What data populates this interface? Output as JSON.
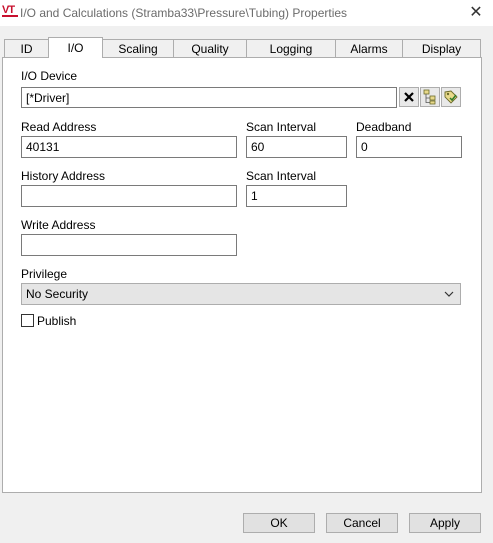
{
  "window": {
    "title": "I/O and Calculations (Stramba33\\Pressure\\Tubing) Properties",
    "icon": "vtscada-logo-icon",
    "logo_text": "VT"
  },
  "tabs": [
    {
      "label": "ID",
      "active": false
    },
    {
      "label": "I/O",
      "active": true
    },
    {
      "label": "Scaling",
      "active": false
    },
    {
      "label": "Quality",
      "active": false
    },
    {
      "label": "Logging",
      "active": false
    },
    {
      "label": "Alarms",
      "active": false
    },
    {
      "label": "Display",
      "active": false
    }
  ],
  "io_device": {
    "label": "I/O Device",
    "value": "[*Driver]"
  },
  "read_address": {
    "label": "Read Address",
    "value": "40131"
  },
  "read_scan_interval": {
    "label": "Scan Interval",
    "value": "60"
  },
  "deadband": {
    "label": "Deadband",
    "value": "0"
  },
  "history_address": {
    "label": "History Address",
    "value": ""
  },
  "history_scan_interval": {
    "label": "Scan Interval",
    "value": "1"
  },
  "write_address": {
    "label": "Write Address",
    "value": ""
  },
  "privilege": {
    "label": "Privilege",
    "value": "No Security"
  },
  "publish": {
    "label": "Publish",
    "checked": false
  },
  "buttons": {
    "ok": "OK",
    "cancel": "Cancel",
    "apply": "Apply"
  },
  "colors": {
    "logo": "#c8102e",
    "title_text": "#6b6b6b",
    "select_bg": "#e5e5e5"
  }
}
